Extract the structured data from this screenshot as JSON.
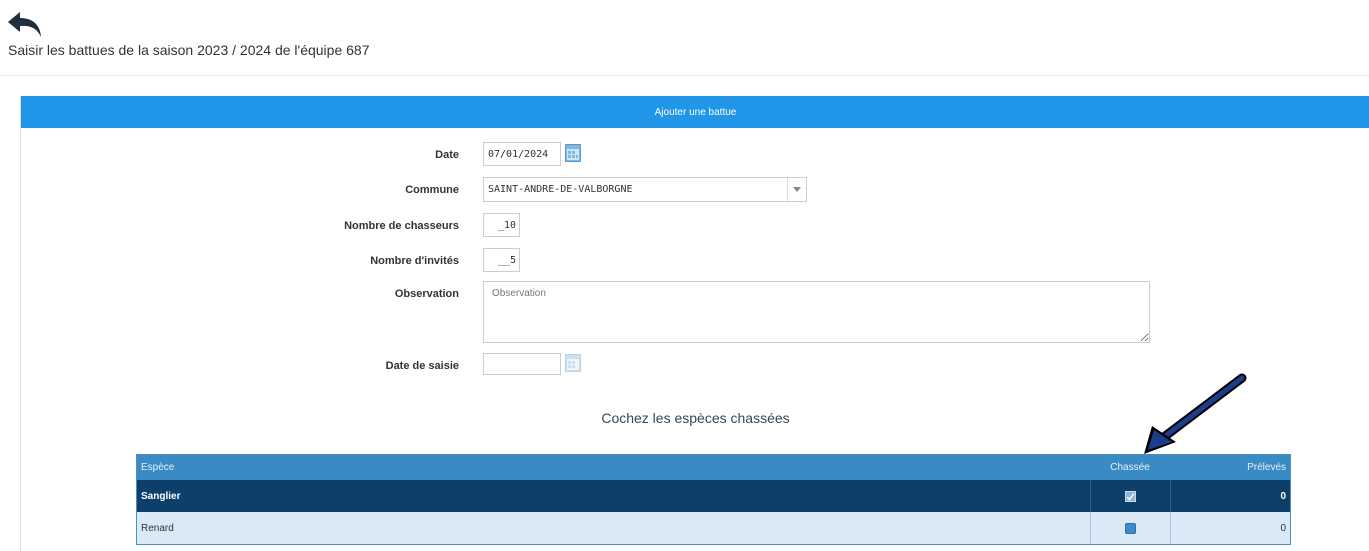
{
  "header": {
    "back_icon": "undo-arrow-icon",
    "title": "Saisir les battues de la saison 2023 / 2024 de l'équipe 687"
  },
  "panel": {
    "title": "Ajouter une battue",
    "accent_color": "#2196e8"
  },
  "form": {
    "date": {
      "label": "Date",
      "value": "07/01/2024",
      "icon": "calendar-icon"
    },
    "commune": {
      "label": "Commune",
      "value": "SAINT-ANDRE-DE-VALBORGNE",
      "icon": "dropdown-caret-icon"
    },
    "nombre_chasseurs": {
      "label": "Nombre de chasseurs",
      "value": "_10"
    },
    "nombre_invites": {
      "label": "Nombre d'invités",
      "value": "__5"
    },
    "observation": {
      "label": "Observation",
      "value": "",
      "placeholder": "Observation"
    },
    "date_saisie": {
      "label": "Date de saisie",
      "value": "",
      "icon": "calendar-icon"
    }
  },
  "species": {
    "title": "Cochez les espèces chassées",
    "columns": [
      "Espèce",
      "Chassée",
      "Prélevés"
    ],
    "rows": [
      {
        "espece": "Sanglier",
        "chassee": true,
        "preleves": "0"
      },
      {
        "espece": "Renard",
        "chassee": false,
        "preleves": "0"
      }
    ],
    "header_color": "#3a8ac4",
    "selected_row_color": "#0e3f6b"
  },
  "annotation": {
    "icon": "pointer-arrow-icon"
  }
}
